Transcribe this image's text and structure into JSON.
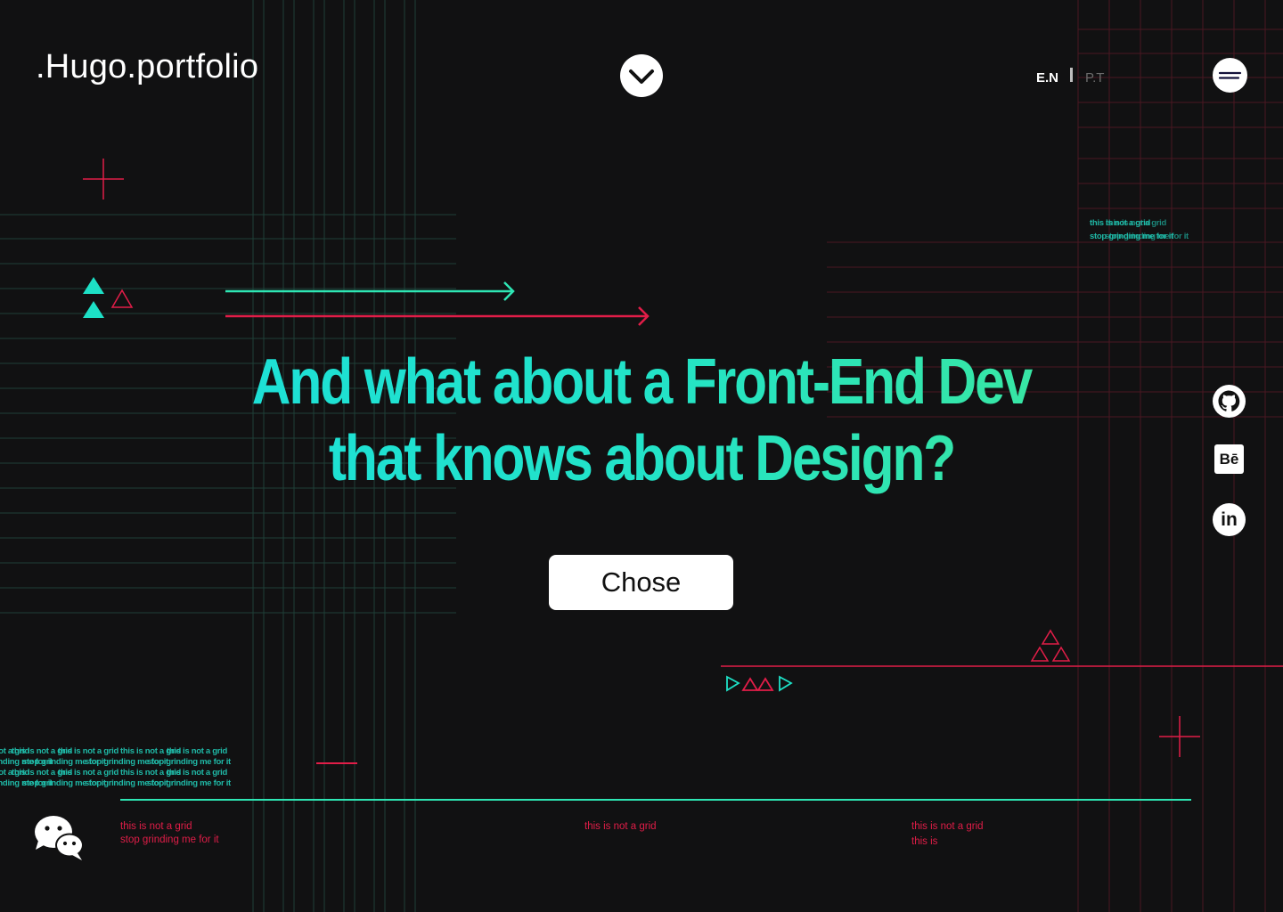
{
  "colors": {
    "background": "#111112",
    "accent_teal": "#1de0d6",
    "accent_green": "#38e6a3",
    "accent_red": "#e11d48",
    "grid_teal": "#1d4a40",
    "grid_red": "#4a1620"
  },
  "header": {
    "logo": ".Hugo.portfolio",
    "scroll_icon": "chevron-down-icon",
    "lang_active": "E.N",
    "lang_inactive": "P.T",
    "menu_icon": "hamburger-menu-icon"
  },
  "hero": {
    "title_line1": "And what about a Front-End Dev",
    "title_line2": "that knows about Design?",
    "cta_label": "Chose"
  },
  "social": {
    "github_icon": "github-icon",
    "behance_label": "Bē",
    "linkedin_label": "in"
  },
  "grid_notes": {
    "top_right_line1": "this is not a grid",
    "top_right_line2": "stop grinding me for it",
    "left_cluster_line1": "this is not a grid",
    "left_cluster_line2": "stop grinding me for it",
    "bottom_note1_line1": "this is not a grid",
    "bottom_note1_line2": "stop grinding me for it",
    "bottom_note2": "this is not a grid",
    "bottom_note3_line1": "this is not a grid",
    "bottom_note3_line2": "this is"
  },
  "chat": {
    "icon": "wechat-chat-icon"
  }
}
